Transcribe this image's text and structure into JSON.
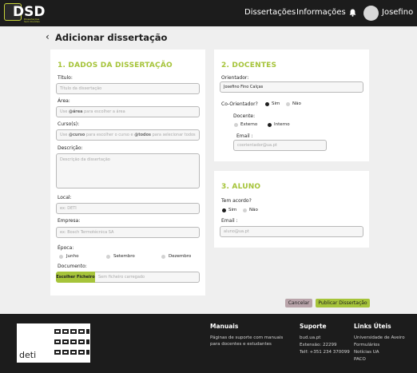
{
  "nav": {
    "logo": "DSD",
    "logo_sub": "Dissertações Sem Dúvidas",
    "links": [
      "Dissertações",
      "Informações"
    ],
    "user": "Josefino"
  },
  "page": {
    "title": "Adicionar dissertação"
  },
  "section1": {
    "title": "1. DADOS DA DISSERTAÇÃO",
    "titulo_label": "Título:",
    "titulo_placeholder": "Título da dissertação",
    "area_label": "Área:",
    "area_hint_pre": "Use ",
    "area_hint_kw": "@área",
    "area_hint_post": " para escolher a área",
    "curso_label": "Curso(s):",
    "curso_hint_pre": "Use ",
    "curso_hint_kw1": "@curso",
    "curso_hint_mid": " para escolher o curso e ",
    "curso_hint_kw2": "@todos",
    "curso_hint_post": " para selecionar todos",
    "descricao_label": "Descrição:",
    "descricao_placeholder": "Descrição da dissertação",
    "local_label": "Local:",
    "local_placeholder": "ex: DETI",
    "empresa_label": "Empresa:",
    "empresa_placeholder": "ex: Bosch Termotécnica SA",
    "epoca_label": "Época:",
    "epoca_options": [
      "Junho",
      "Setembro",
      "Dezembro"
    ],
    "documento_label": "Documento:",
    "file_button": "Escolher Ficheiro",
    "file_status": "Sem ficheiro carregado"
  },
  "section2": {
    "title": "2. DOCENTES",
    "orientador_label": "Orientador:",
    "orientador_value": "Josefino Fino Calças",
    "coorientador_label": "Co-Orientador?",
    "co_options": [
      "Sim",
      "Não"
    ],
    "docente_label": "Docente:",
    "docente_options": [
      "Externo",
      "Interno"
    ],
    "email_label": "Email :",
    "email_placeholder": "coorientador@ua.pt"
  },
  "section3": {
    "title": "3. ALUNO",
    "acordo_label": "Tem acordo?",
    "acordo_options": [
      "Sim",
      "Não"
    ],
    "email_label": "Email :",
    "email_placeholder": "aluno@ua.pt"
  },
  "actions": {
    "cancel": "Cancelar",
    "publish": "Publicar Dissertação"
  },
  "footer": {
    "deti": "deti",
    "manuais_title": "Manuais",
    "manuais_text": "Páginas de suporte com manuais para docentes e estudantes",
    "suporte_title": "Suporte",
    "suporte_lines": [
      "bud.ua.pt",
      "Extensão: 22299",
      "Telf: +351 234 370099"
    ],
    "links_title": "Links Úteis",
    "links": [
      "Universidade de Aveiro",
      "Formulários",
      "Notícias UA",
      "PACO"
    ]
  },
  "colors": {
    "accent": "#a6c43a",
    "dark": "#1c1c1c",
    "cancel": "#b9a4aa"
  }
}
